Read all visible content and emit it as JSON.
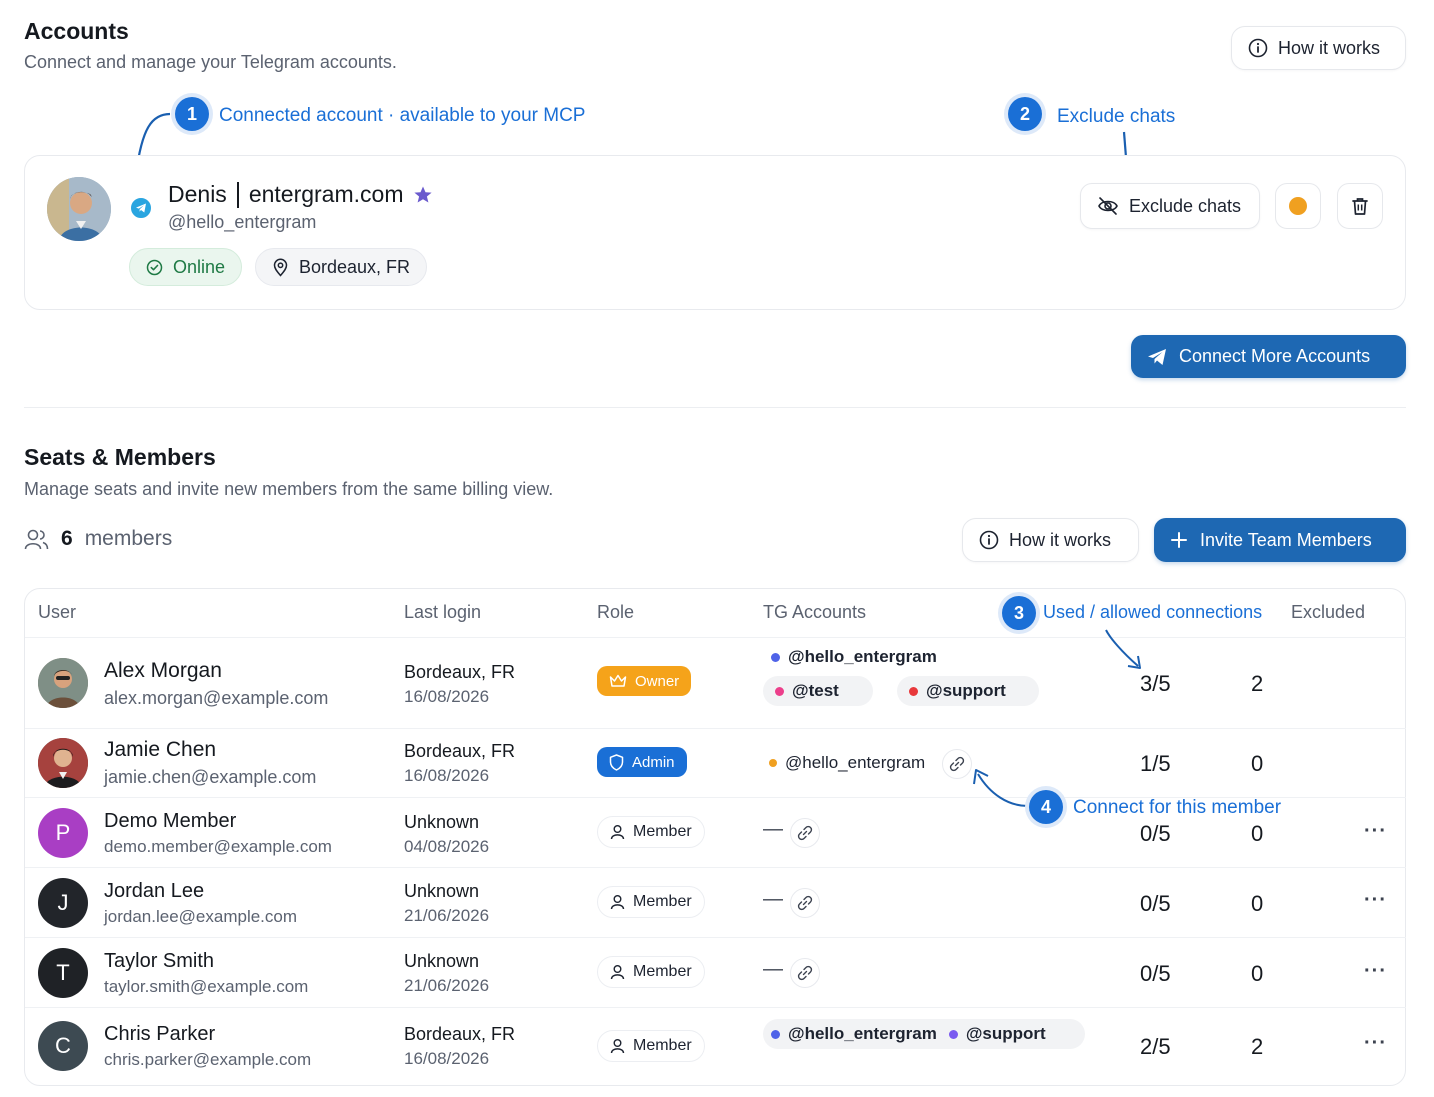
{
  "accounts": {
    "title": "Accounts",
    "subtitle": "Connect and manage your Telegram accounts.",
    "how_it_works": "How it works",
    "callout1": {
      "num": "1",
      "label": "Connected account · available to your MCP"
    },
    "callout2": {
      "num": "2",
      "label": "Exclude chats"
    },
    "account": {
      "name": "Denis",
      "domain": "entergram.com",
      "handle": "@hello_entergram",
      "status": "Online",
      "location": "Bordeaux, FR"
    },
    "exclude_chats": "Exclude chats",
    "connect_more": "Connect More Accounts"
  },
  "seats": {
    "title": "Seats & Members",
    "subtitle": "Manage seats and invite new members from the same billing view.",
    "member_count": "6",
    "member_word": "members",
    "how_it_works": "How it works",
    "invite": "Invite Team Members",
    "callout3": {
      "num": "3",
      "label": "Used / allowed connections"
    },
    "callout4": {
      "num": "4",
      "label": "Connect for this member"
    },
    "columns": [
      "User",
      "Last login",
      "Role",
      "TG Accounts",
      "Excluded"
    ],
    "rows": [
      {
        "name": "Alex Morgan",
        "email": "alex.morgan@example.com",
        "location": "Bordeaux, FR",
        "date": "16/08/2026",
        "role": "Owner",
        "accounts": [
          "@hello_entergram",
          "@test",
          "@support"
        ],
        "used": "3/5",
        "excluded": "2"
      },
      {
        "name": "Jamie Chen",
        "email": "jamie.chen@example.com",
        "location": "Bordeaux, FR",
        "date": "16/08/2026",
        "role": "Admin",
        "accounts": [
          "@hello_entergram"
        ],
        "used": "1/5",
        "excluded": "0"
      },
      {
        "name": "Demo Member",
        "initial": "P",
        "email": "demo.member@example.com",
        "location": "Unknown",
        "date": "04/08/2026",
        "role": "Member",
        "accounts_empty": "—",
        "used": "0/5",
        "excluded": "0"
      },
      {
        "name": "Jordan Lee",
        "initial": "J",
        "email": "jordan.lee@example.com",
        "location": "Unknown",
        "date": "21/06/2026",
        "role": "Member",
        "accounts_empty": "—",
        "used": "0/5",
        "excluded": "0"
      },
      {
        "name": "Taylor Smith",
        "initial": "T",
        "email": "taylor.smith@example.com",
        "location": "Unknown",
        "date": "21/06/2026",
        "role": "Member",
        "accounts_empty": "—",
        "used": "0/5",
        "excluded": "0"
      },
      {
        "name": "Chris Parker",
        "initial": "C",
        "email": "chris.parker@example.com",
        "location": "Bordeaux, FR",
        "date": "16/08/2026",
        "role": "Member",
        "accounts": [
          "@hello_entergram",
          "@support"
        ],
        "used": "2/5",
        "excluded": "2"
      }
    ],
    "more": "···"
  },
  "colors": {
    "primary": "#1e68b3",
    "step": "#1a6fd6",
    "owner": "#f5a31a",
    "online": "#1f7a45",
    "status_dot": "#f0a020"
  }
}
